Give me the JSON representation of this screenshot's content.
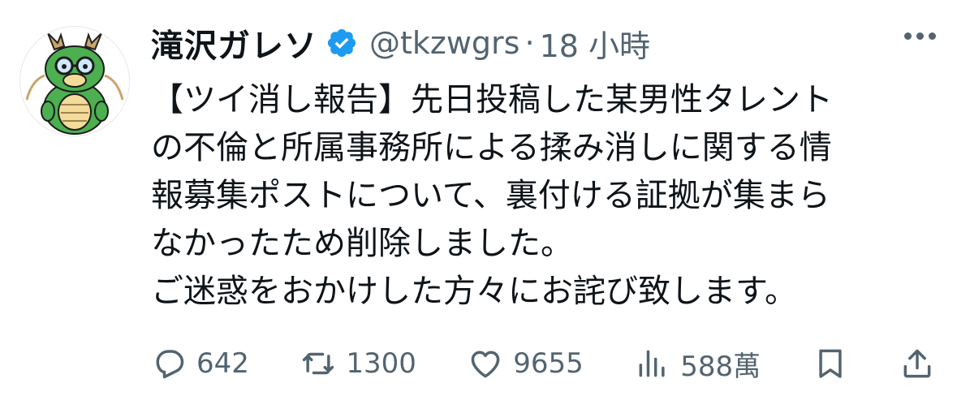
{
  "tweet": {
    "display_name": "滝沢ガレソ",
    "handle": "@tkzwgrs",
    "separator": "·",
    "time": "18 小時",
    "lines": [
      "【ツイ消し報告】先日投稿した某男性タレント",
      "の不倫と所属事務所による揉み消しに関する情",
      "報募集ポストについて、裏付ける証拠が集まら",
      "なかったため削除しました。",
      "ご迷惑をおかけした方々にお詫び致します。"
    ]
  },
  "actions": {
    "replies": "642",
    "reposts": "1300",
    "likes": "9655",
    "views": "588萬"
  },
  "icons": {
    "verified": "verified-badge-icon",
    "more": "more-icon",
    "reply": "reply-icon",
    "repost": "repost-icon",
    "like": "heart-icon",
    "views": "views-icon",
    "bookmark": "bookmark-icon",
    "share": "share-icon"
  },
  "colors": {
    "text": "#0f1419",
    "secondary": "#536471",
    "verified": "#1d9bf0",
    "avatar_dragon": "#4caf50"
  }
}
